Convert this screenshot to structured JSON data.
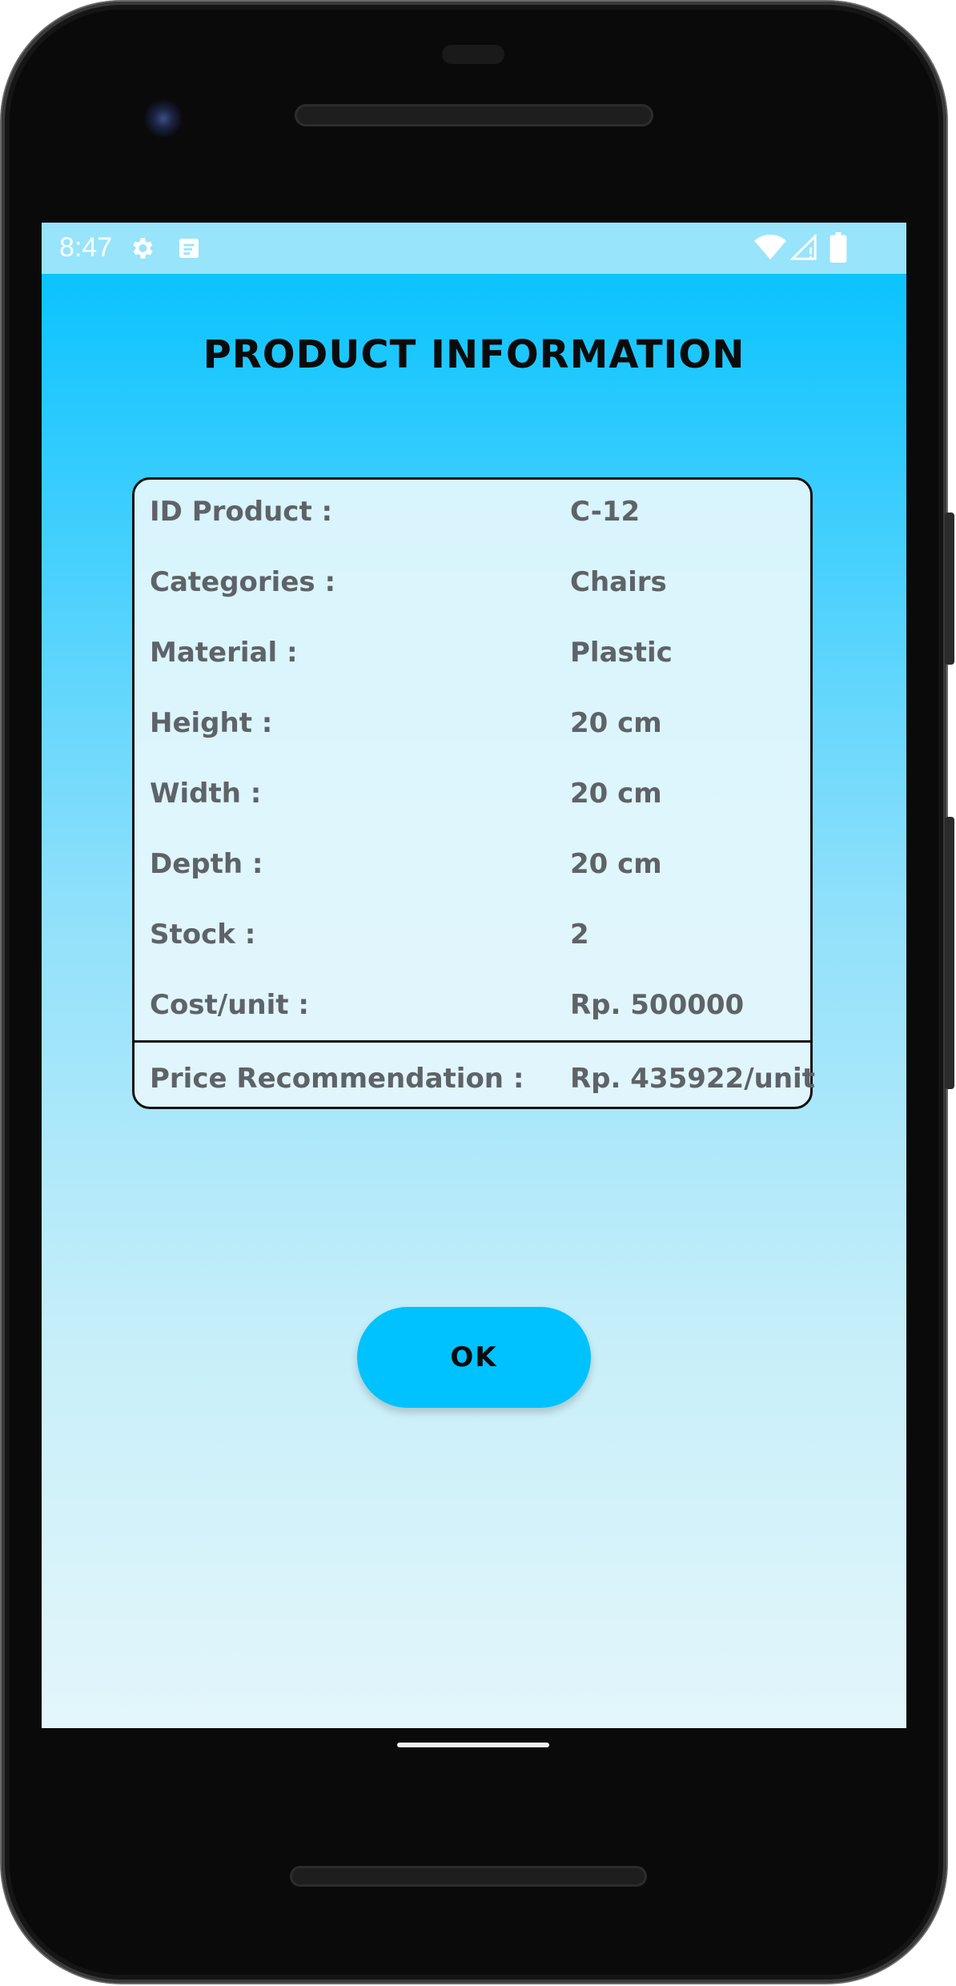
{
  "status_bar": {
    "time": "8:47",
    "icons": [
      "gear-icon",
      "notification-icon",
      "wifi-icon",
      "signal-icon",
      "battery-icon"
    ]
  },
  "title": "PRODUCT INFORMATION",
  "product": {
    "rows": [
      {
        "label": "ID Product :",
        "value": "C-12"
      },
      {
        "label": "Categories :",
        "value": "Chairs"
      },
      {
        "label": "Material :",
        "value": "Plastic"
      },
      {
        "label": "Height :",
        "value": "20 cm"
      },
      {
        "label": "Width :",
        "value": "20 cm"
      },
      {
        "label": "Depth :",
        "value": "20 cm"
      },
      {
        "label": "Stock :",
        "value": "2"
      },
      {
        "label": "Cost/unit :",
        "value": "Rp. 500000"
      }
    ],
    "recommendation": {
      "label": "Price Recommendation :",
      "value": "Rp. 435922/unit"
    }
  },
  "ok_button": {
    "label": "OK"
  },
  "colors": {
    "accent": "#00c2ff",
    "status_bar": "#98e4fb",
    "text_muted": "#5e6368"
  }
}
